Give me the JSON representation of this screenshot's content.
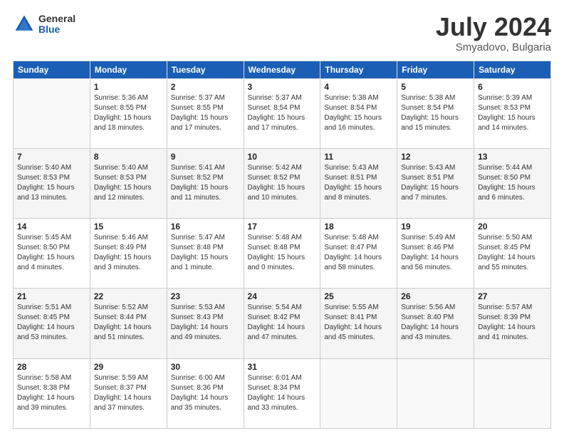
{
  "header": {
    "logo_general": "General",
    "logo_blue": "Blue",
    "main_title": "July 2024",
    "subtitle": "Smyadovo, Bulgaria"
  },
  "weekdays": [
    "Sunday",
    "Monday",
    "Tuesday",
    "Wednesday",
    "Thursday",
    "Friday",
    "Saturday"
  ],
  "weeks": [
    [
      {
        "day": "",
        "info": ""
      },
      {
        "day": "1",
        "info": "Sunrise: 5:36 AM\nSunset: 8:55 PM\nDaylight: 15 hours\nand 18 minutes."
      },
      {
        "day": "2",
        "info": "Sunrise: 5:37 AM\nSunset: 8:55 PM\nDaylight: 15 hours\nand 17 minutes."
      },
      {
        "day": "3",
        "info": "Sunrise: 5:37 AM\nSunset: 8:54 PM\nDaylight: 15 hours\nand 17 minutes."
      },
      {
        "day": "4",
        "info": "Sunrise: 5:38 AM\nSunset: 8:54 PM\nDaylight: 15 hours\nand 16 minutes."
      },
      {
        "day": "5",
        "info": "Sunrise: 5:38 AM\nSunset: 8:54 PM\nDaylight: 15 hours\nand 15 minutes."
      },
      {
        "day": "6",
        "info": "Sunrise: 5:39 AM\nSunset: 8:53 PM\nDaylight: 15 hours\nand 14 minutes."
      }
    ],
    [
      {
        "day": "7",
        "info": "Sunrise: 5:40 AM\nSunset: 8:53 PM\nDaylight: 15 hours\nand 13 minutes."
      },
      {
        "day": "8",
        "info": "Sunrise: 5:40 AM\nSunset: 8:53 PM\nDaylight: 15 hours\nand 12 minutes."
      },
      {
        "day": "9",
        "info": "Sunrise: 5:41 AM\nSunset: 8:52 PM\nDaylight: 15 hours\nand 11 minutes."
      },
      {
        "day": "10",
        "info": "Sunrise: 5:42 AM\nSunset: 8:52 PM\nDaylight: 15 hours\nand 10 minutes."
      },
      {
        "day": "11",
        "info": "Sunrise: 5:43 AM\nSunset: 8:51 PM\nDaylight: 15 hours\nand 8 minutes."
      },
      {
        "day": "12",
        "info": "Sunrise: 5:43 AM\nSunset: 8:51 PM\nDaylight: 15 hours\nand 7 minutes."
      },
      {
        "day": "13",
        "info": "Sunrise: 5:44 AM\nSunset: 8:50 PM\nDaylight: 15 hours\nand 6 minutes."
      }
    ],
    [
      {
        "day": "14",
        "info": "Sunrise: 5:45 AM\nSunset: 8:50 PM\nDaylight: 15 hours\nand 4 minutes."
      },
      {
        "day": "15",
        "info": "Sunrise: 5:46 AM\nSunset: 8:49 PM\nDaylight: 15 hours\nand 3 minutes."
      },
      {
        "day": "16",
        "info": "Sunrise: 5:47 AM\nSunset: 8:48 PM\nDaylight: 15 hours\nand 1 minute."
      },
      {
        "day": "17",
        "info": "Sunrise: 5:48 AM\nSunset: 8:48 PM\nDaylight: 15 hours\nand 0 minutes."
      },
      {
        "day": "18",
        "info": "Sunrise: 5:48 AM\nSunset: 8:47 PM\nDaylight: 14 hours\nand 58 minutes."
      },
      {
        "day": "19",
        "info": "Sunrise: 5:49 AM\nSunset: 8:46 PM\nDaylight: 14 hours\nand 56 minutes."
      },
      {
        "day": "20",
        "info": "Sunrise: 5:50 AM\nSunset: 8:45 PM\nDaylight: 14 hours\nand 55 minutes."
      }
    ],
    [
      {
        "day": "21",
        "info": "Sunrise: 5:51 AM\nSunset: 8:45 PM\nDaylight: 14 hours\nand 53 minutes."
      },
      {
        "day": "22",
        "info": "Sunrise: 5:52 AM\nSunset: 8:44 PM\nDaylight: 14 hours\nand 51 minutes."
      },
      {
        "day": "23",
        "info": "Sunrise: 5:53 AM\nSunset: 8:43 PM\nDaylight: 14 hours\nand 49 minutes."
      },
      {
        "day": "24",
        "info": "Sunrise: 5:54 AM\nSunset: 8:42 PM\nDaylight: 14 hours\nand 47 minutes."
      },
      {
        "day": "25",
        "info": "Sunrise: 5:55 AM\nSunset: 8:41 PM\nDaylight: 14 hours\nand 45 minutes."
      },
      {
        "day": "26",
        "info": "Sunrise: 5:56 AM\nSunset: 8:40 PM\nDaylight: 14 hours\nand 43 minutes."
      },
      {
        "day": "27",
        "info": "Sunrise: 5:57 AM\nSunset: 8:39 PM\nDaylight: 14 hours\nand 41 minutes."
      }
    ],
    [
      {
        "day": "28",
        "info": "Sunrise: 5:58 AM\nSunset: 8:38 PM\nDaylight: 14 hours\nand 39 minutes."
      },
      {
        "day": "29",
        "info": "Sunrise: 5:59 AM\nSunset: 8:37 PM\nDaylight: 14 hours\nand 37 minutes."
      },
      {
        "day": "30",
        "info": "Sunrise: 6:00 AM\nSunset: 8:36 PM\nDaylight: 14 hours\nand 35 minutes."
      },
      {
        "day": "31",
        "info": "Sunrise: 6:01 AM\nSunset: 8:34 PM\nDaylight: 14 hours\nand 33 minutes."
      },
      {
        "day": "",
        "info": ""
      },
      {
        "day": "",
        "info": ""
      },
      {
        "day": "",
        "info": ""
      }
    ]
  ]
}
